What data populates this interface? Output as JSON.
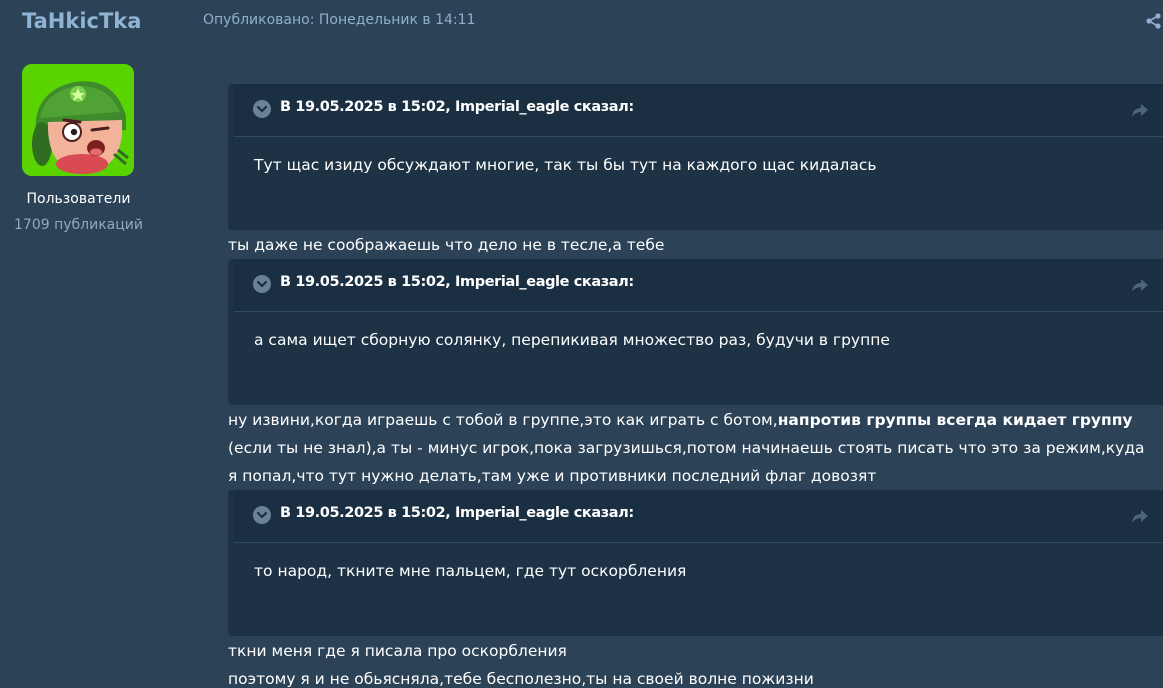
{
  "post": {
    "author": "TaHkicTka",
    "published": "Опубликовано: Понедельник в 14:11",
    "group": "Пользователи",
    "post_count": "1709 публикаций"
  },
  "quotes": [
    {
      "cite": "В 19.05.2025 в 15:02, Imperial_eagle сказал:",
      "text": "Тут щас изиду обсуждают многие, так ты бы тут на каждого щас кидалась"
    },
    {
      "cite": "В 19.05.2025 в 15:02, Imperial_eagle сказал:",
      "text": "а сама ищет сборную солянку, перепикивая множество раз, будучи в группе"
    },
    {
      "cite": "В 19.05.2025 в 15:02, Imperial_eagle сказал:",
      "text": "то народ, ткните мне пальцем, где тут оскорбления"
    }
  ],
  "replies": {
    "r1": "ты даже не соображаешь что дело не в тесле,а тебе",
    "r2_a": "ну извини,когда играешь с тобой в группе,это как играть с ботом,",
    "r2_bold": "напротив группы всегда кидает группу",
    "r2_b": "(если ты не знал),а ты - минус игрок,пока загрузишься,потом начинаешь стоять писать что это за режим,куда",
    "r2_c": "я попал,что тут нужно делать,там уже и противники последний флаг довозят",
    "r3_a": "ткни меня где я писала про оскорбления",
    "r3_b": "поэтому я и не обьясняла,тебе бесполезно,ты на своей волне пожизни"
  },
  "icons": {
    "share": "share-icon",
    "quote_expand": "chevron-down-icon",
    "quote_jump": "forward-arrow-icon"
  },
  "colors": {
    "background": "#2c4257",
    "quote_bg": "#1d3245",
    "username": "#8fb3d3"
  }
}
